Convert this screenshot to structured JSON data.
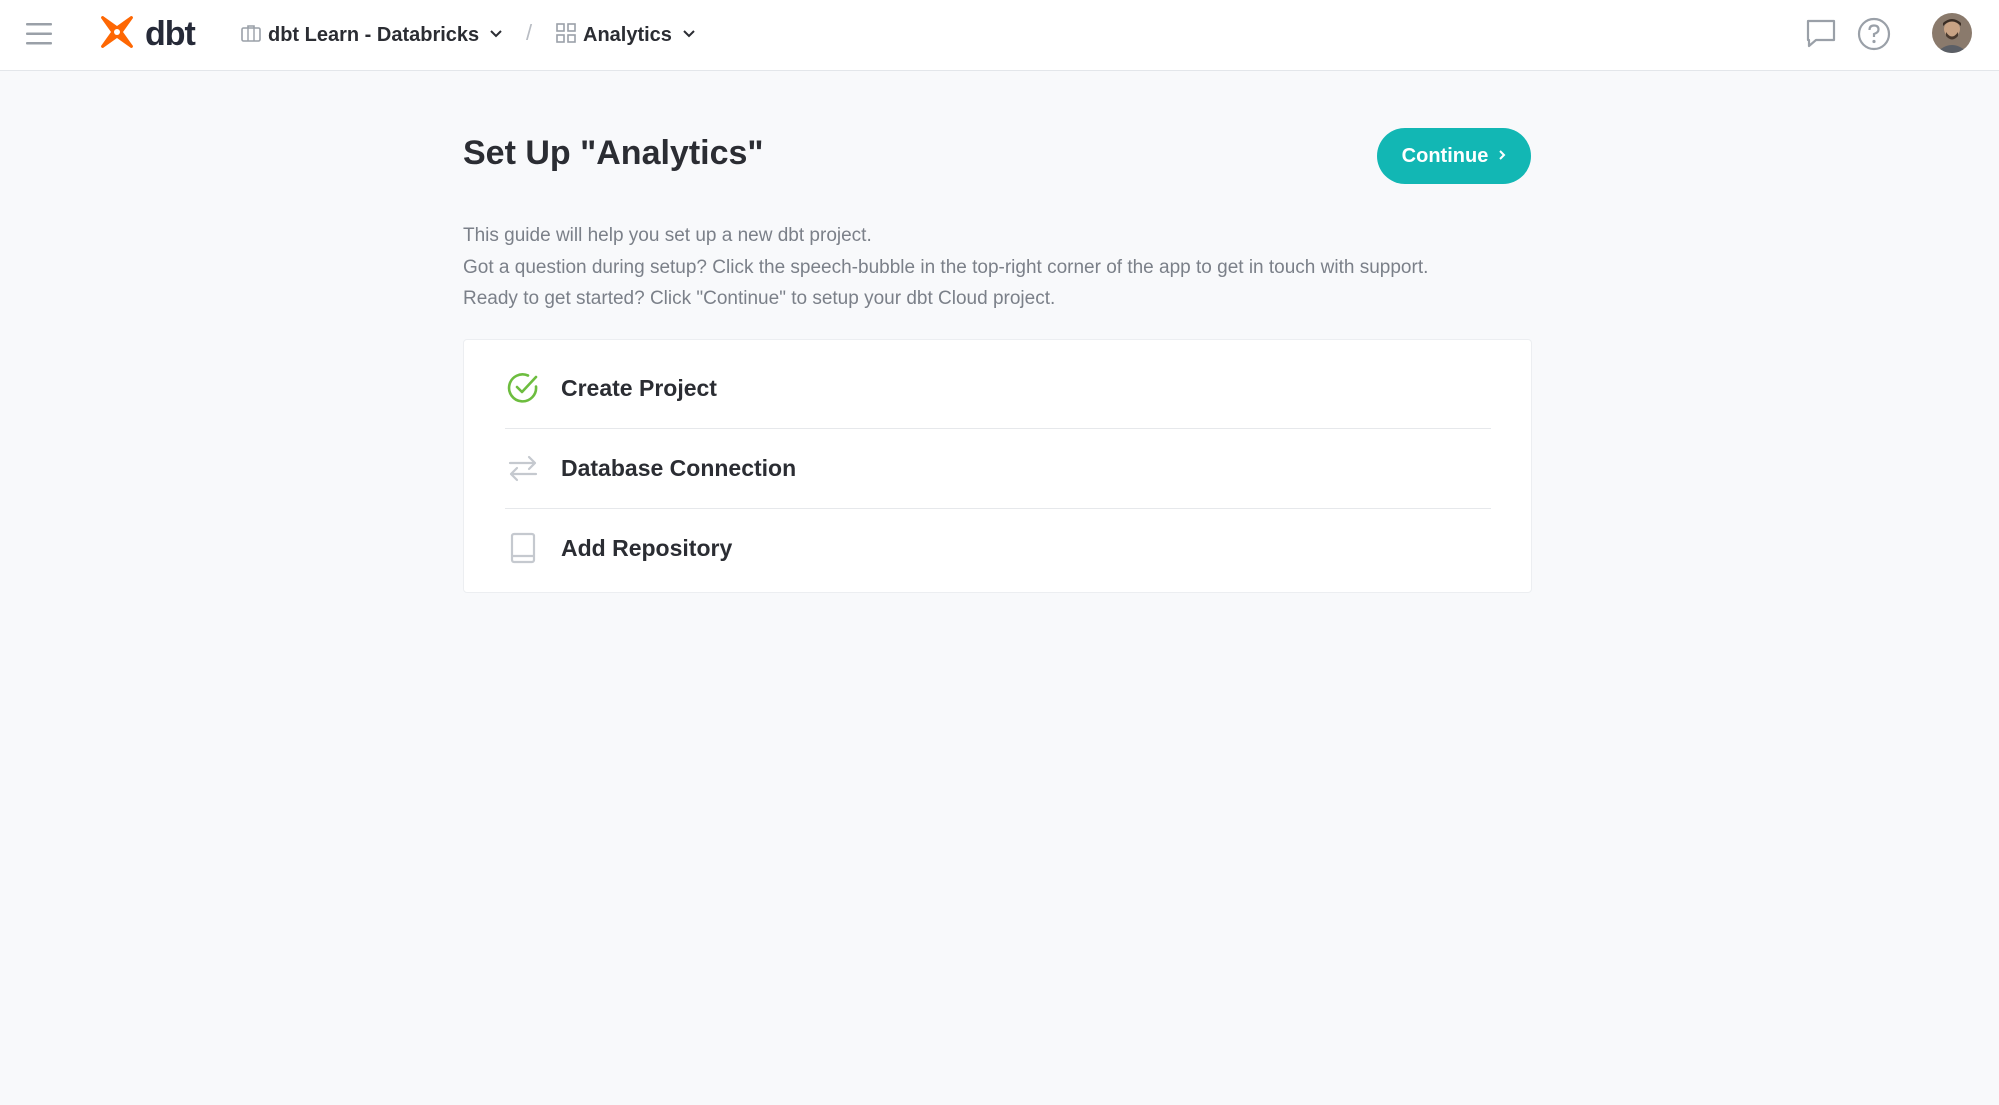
{
  "topbar": {
    "logo_text": "dbt",
    "account": {
      "label": "dbt Learn - Databricks",
      "icon": "briefcase-icon"
    },
    "project": {
      "label": "Analytics",
      "icon": "grid-icon"
    },
    "separator": "/",
    "actions": [
      {
        "name": "chat-icon"
      },
      {
        "name": "help-icon"
      },
      {
        "name": "avatar"
      }
    ]
  },
  "main": {
    "title": "Set Up \"Analytics\"",
    "continue_label": "Continue",
    "intro_lines": [
      "This guide will help you set up a new dbt project.",
      "Got a question during setup? Click the speech-bubble in the top-right corner of the app to get in touch with support.",
      "Ready to get started? Click \"Continue\" to setup your dbt Cloud project."
    ],
    "steps": [
      {
        "label": "Create Project",
        "icon": "check-circle-icon",
        "status": "complete"
      },
      {
        "label": "Database Connection",
        "icon": "arrows-exchange-icon",
        "status": "pending"
      },
      {
        "label": "Add Repository",
        "icon": "book-icon",
        "status": "pending"
      }
    ]
  },
  "colors": {
    "accent": "#12b7b4",
    "brand": "#fe6703",
    "complete": "#6dbd3f",
    "background": "#f8f9fb",
    "text": "#2b2d33",
    "muted": "#7b8089"
  }
}
